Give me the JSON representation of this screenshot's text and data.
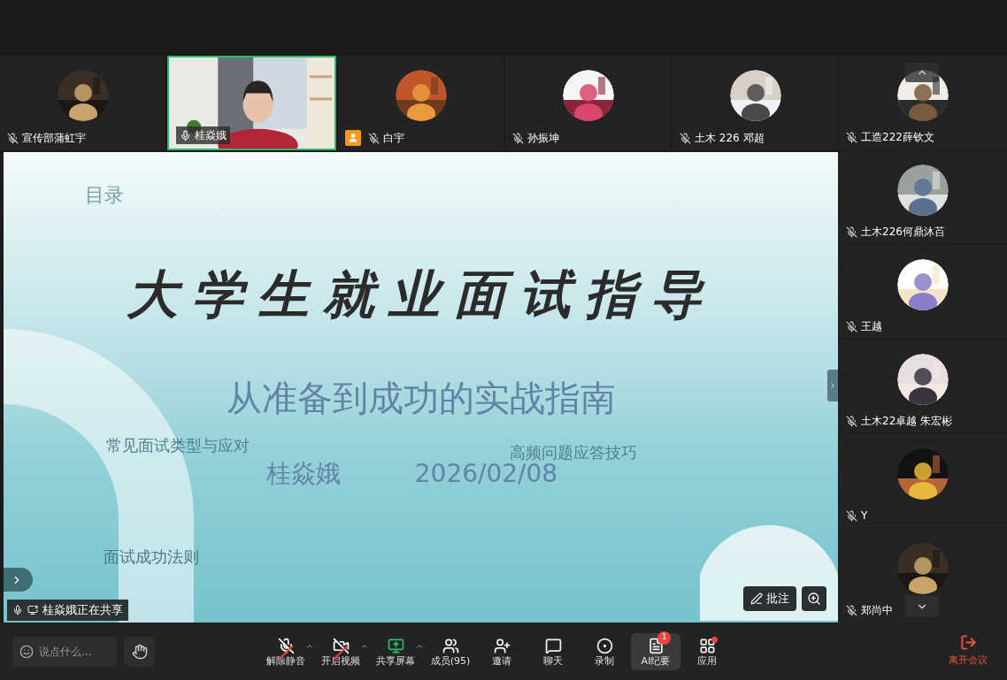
{
  "top_tiles": [
    {
      "name": "宣传部蒲虹宇",
      "muted": true,
      "kind": "avatar",
      "speaking": false,
      "host": false
    },
    {
      "name": "桂焱娥",
      "muted": false,
      "kind": "video",
      "speaking": true,
      "host": false
    },
    {
      "name": "白宇",
      "muted": true,
      "kind": "avatar",
      "speaking": false,
      "host": true
    },
    {
      "name": "孙振坤",
      "muted": true,
      "kind": "avatar",
      "speaking": false,
      "host": false
    },
    {
      "name": "土木 226 邓超",
      "muted": true,
      "kind": "avatar",
      "speaking": false,
      "host": false
    }
  ],
  "side_tiles": [
    {
      "name": "工造222薛钦文",
      "muted": true,
      "kind": "avatar",
      "speaking": false,
      "host": false
    },
    {
      "name": "土木226何鼎沐苩",
      "muted": true,
      "kind": "avatar",
      "speaking": false,
      "host": false
    },
    {
      "name": "王越",
      "muted": true,
      "kind": "avatar",
      "speaking": false,
      "host": false
    },
    {
      "name": "土木22卓越 朱宏彬",
      "muted": true,
      "kind": "avatar",
      "speaking": false,
      "host": false
    },
    {
      "name": "Y",
      "muted": true,
      "kind": "avatar",
      "speaking": false,
      "host": false
    },
    {
      "name": "郑尚中",
      "muted": true,
      "kind": "avatar",
      "speaking": false,
      "host": false
    }
  ],
  "slide": {
    "title": "大学生就业面试指导",
    "subtitle": "从准备到成功的实战指南",
    "author": "桂焱娥",
    "date": "2026/02/08",
    "ghost_texts": [
      "目录",
      "常见面试类型与应对",
      "高频问题应答技巧",
      "面试成功法则"
    ]
  },
  "sharing_label": "桂焱娥正在共享",
  "annotate_button": "批注",
  "chat_input": {
    "placeholder": "说点什么..."
  },
  "toolbar": [
    {
      "label": "解除静音",
      "off": true,
      "menu": true,
      "selected": false,
      "dot": false
    },
    {
      "label": "开启视频",
      "off": true,
      "menu": true,
      "selected": false,
      "dot": false
    },
    {
      "label": "共享屏幕",
      "off": false,
      "menu": true,
      "selected": false,
      "dot": false
    },
    {
      "label": "成员(95)",
      "off": false,
      "menu": false,
      "selected": false,
      "dot": false
    },
    {
      "label": "邀请",
      "off": false,
      "menu": false,
      "selected": false,
      "dot": false
    },
    {
      "label": "聊天",
      "off": false,
      "menu": false,
      "selected": false,
      "dot": false
    },
    {
      "label": "录制",
      "off": false,
      "menu": false,
      "selected": false,
      "dot": false
    },
    {
      "label": "AI纪要",
      "off": false,
      "menu": false,
      "selected": true,
      "dot": false,
      "badge": "1"
    },
    {
      "label": "应用",
      "off": false,
      "menu": false,
      "selected": false,
      "dot": true
    }
  ],
  "leave_button": "离开会议"
}
